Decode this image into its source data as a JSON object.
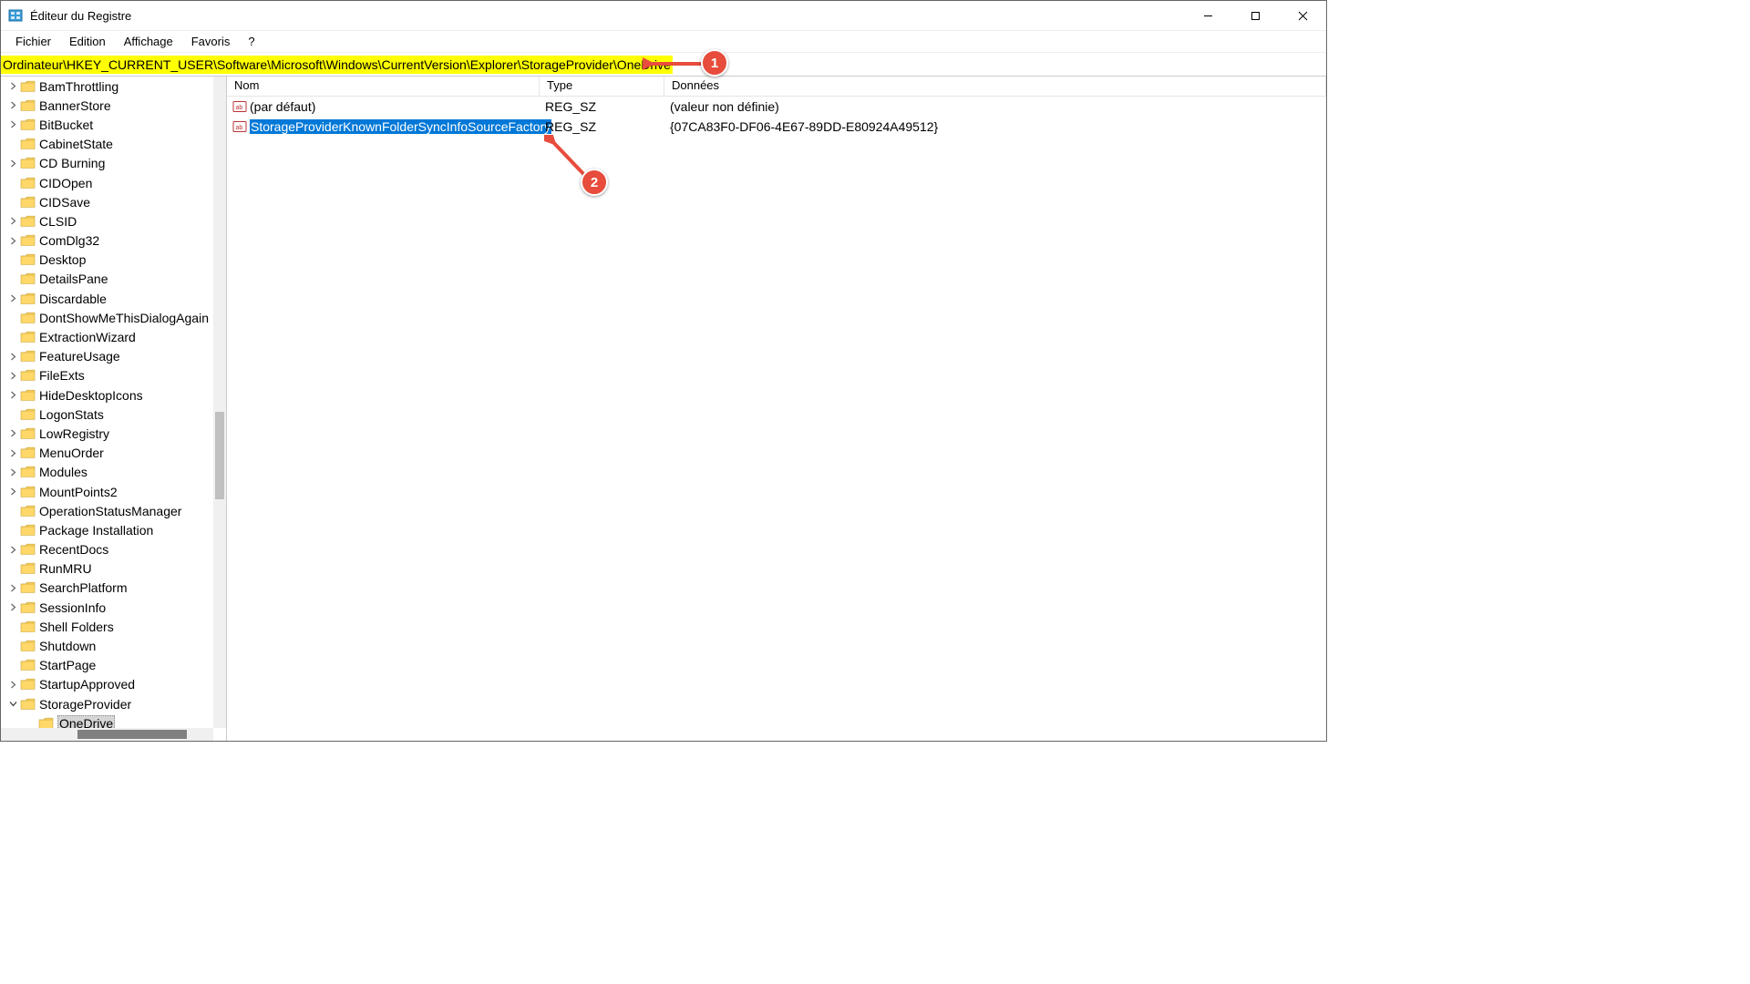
{
  "title": "Éditeur du Registre",
  "menu": [
    "Fichier",
    "Edition",
    "Affichage",
    "Favoris",
    "?"
  ],
  "address": "Ordinateur\\HKEY_CURRENT_USER\\Software\\Microsoft\\Windows\\CurrentVersion\\Explorer\\StorageProvider\\OneDrive",
  "columns": {
    "name": "Nom",
    "type": "Type",
    "data": "Données"
  },
  "tree": [
    {
      "label": "BamThrottling",
      "expand": true,
      "indent": 1
    },
    {
      "label": "BannerStore",
      "expand": true,
      "indent": 1
    },
    {
      "label": "BitBucket",
      "expand": true,
      "indent": 1
    },
    {
      "label": "CabinetState",
      "expand": false,
      "indent": 1
    },
    {
      "label": "CD Burning",
      "expand": true,
      "indent": 1
    },
    {
      "label": "CIDOpen",
      "expand": false,
      "indent": 1
    },
    {
      "label": "CIDSave",
      "expand": false,
      "indent": 1
    },
    {
      "label": "CLSID",
      "expand": true,
      "indent": 1
    },
    {
      "label": "ComDlg32",
      "expand": true,
      "indent": 1
    },
    {
      "label": "Desktop",
      "expand": false,
      "indent": 1
    },
    {
      "label": "DetailsPane",
      "expand": false,
      "indent": 1
    },
    {
      "label": "Discardable",
      "expand": true,
      "indent": 1
    },
    {
      "label": "DontShowMeThisDialogAgain",
      "expand": false,
      "indent": 1
    },
    {
      "label": "ExtractionWizard",
      "expand": false,
      "indent": 1
    },
    {
      "label": "FeatureUsage",
      "expand": true,
      "indent": 1
    },
    {
      "label": "FileExts",
      "expand": true,
      "indent": 1
    },
    {
      "label": "HideDesktopIcons",
      "expand": true,
      "indent": 1
    },
    {
      "label": "LogonStats",
      "expand": false,
      "indent": 1
    },
    {
      "label": "LowRegistry",
      "expand": true,
      "indent": 1
    },
    {
      "label": "MenuOrder",
      "expand": true,
      "indent": 1
    },
    {
      "label": "Modules",
      "expand": true,
      "indent": 1
    },
    {
      "label": "MountPoints2",
      "expand": true,
      "indent": 1
    },
    {
      "label": "OperationStatusManager",
      "expand": false,
      "indent": 1
    },
    {
      "label": "Package Installation",
      "expand": false,
      "indent": 1
    },
    {
      "label": "RecentDocs",
      "expand": true,
      "indent": 1
    },
    {
      "label": "RunMRU",
      "expand": false,
      "indent": 1
    },
    {
      "label": "SearchPlatform",
      "expand": true,
      "indent": 1
    },
    {
      "label": "SessionInfo",
      "expand": true,
      "indent": 1
    },
    {
      "label": "Shell Folders",
      "expand": false,
      "indent": 1
    },
    {
      "label": "Shutdown",
      "expand": false,
      "indent": 1
    },
    {
      "label": "StartPage",
      "expand": false,
      "indent": 1
    },
    {
      "label": "StartupApproved",
      "expand": true,
      "indent": 1
    },
    {
      "label": "StorageProvider",
      "expand": true,
      "open": true,
      "indent": 1
    },
    {
      "label": "OneDrive",
      "expand": false,
      "indent": 2,
      "selected": true
    }
  ],
  "values": [
    {
      "name": "(par défaut)",
      "type": "REG_SZ",
      "data": "(valeur non définie)",
      "selected": false
    },
    {
      "name": "StorageProviderKnownFolderSyncInfoSourceFactory ",
      "type": "REG_SZ",
      "data": "{07CA83F0-DF06-4E67-89DD-E80924A49512}",
      "selected": true
    }
  ],
  "annot": {
    "one": "1",
    "two": "2"
  }
}
